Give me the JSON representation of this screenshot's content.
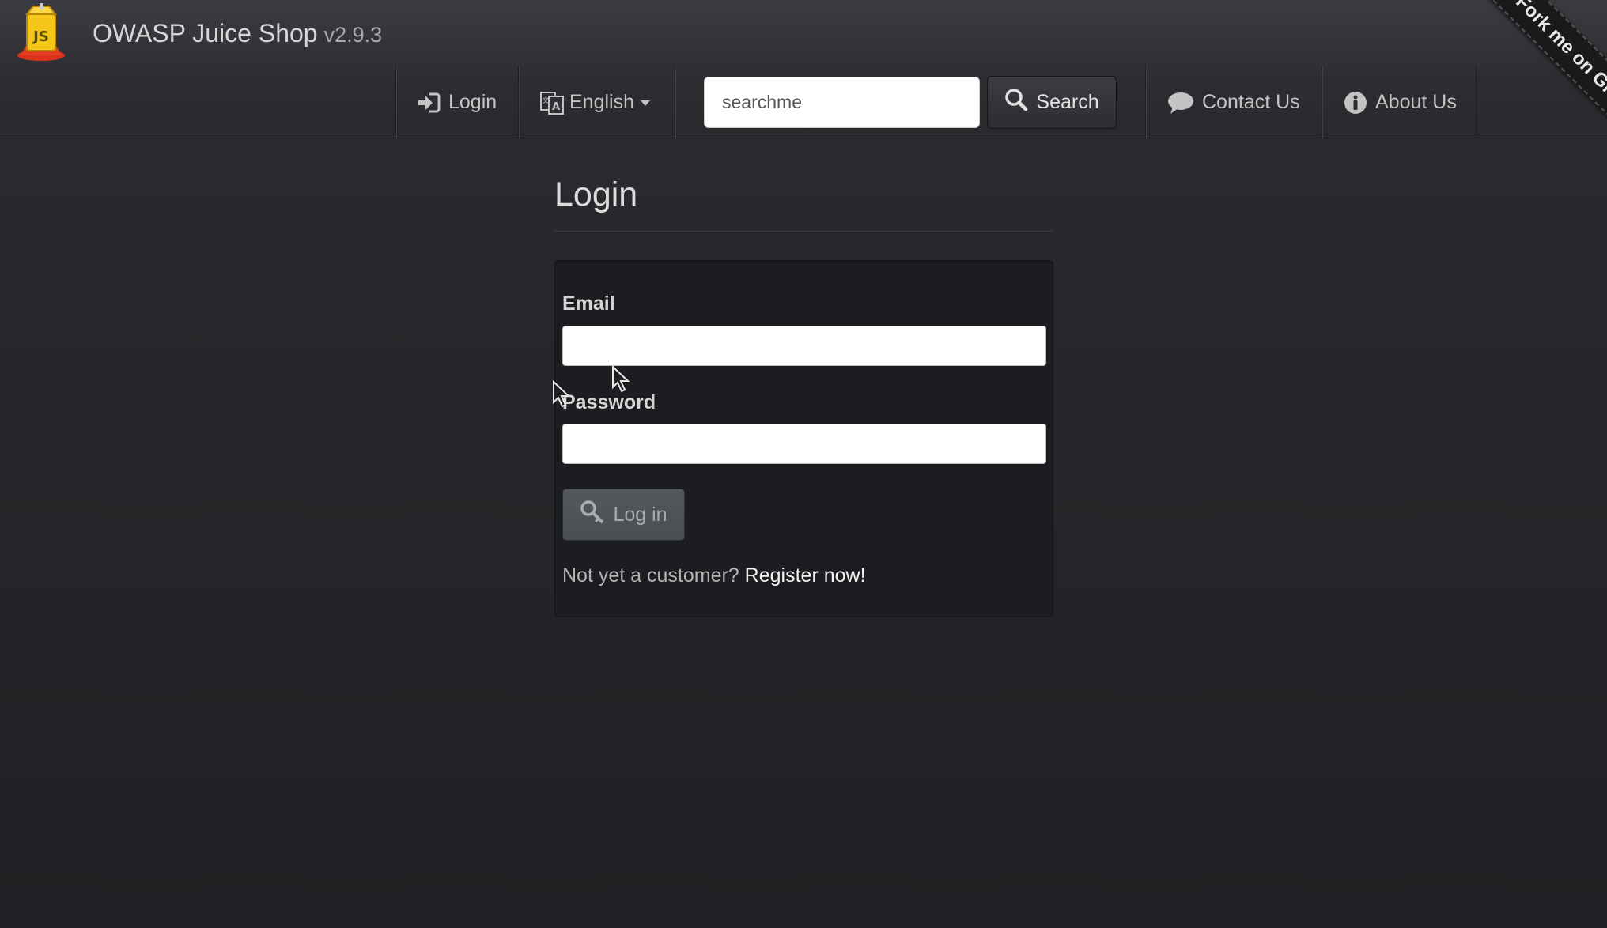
{
  "brand": {
    "name": "OWASP Juice Shop",
    "version": "v2.9.3",
    "logo_text": "JS"
  },
  "nav": {
    "login_label": "Login",
    "language_label": "English",
    "search_value": "searchme",
    "search_button_label": "Search",
    "contact_label": "Contact Us",
    "about_label": "About Us"
  },
  "ribbon": {
    "text": "Fork me on GitHub"
  },
  "login_form": {
    "title": "Login",
    "email_label": "Email",
    "email_value": "",
    "password_label": "Password",
    "password_value": "",
    "submit_label": "Log in",
    "register_prompt": "Not yet a customer?",
    "register_link": "Register now!"
  },
  "colors": {
    "background": "#222326",
    "navbar": "#2b2d31",
    "panel": "#1c1d20",
    "logo_yellow": "#f5c518",
    "logo_red": "#d9331a"
  },
  "icons": [
    "juice-shop-logo",
    "sign-in-icon",
    "language-icon",
    "caret-down-icon",
    "search-icon",
    "comment-icon",
    "info-icon",
    "key-icon",
    "mouse-cursor"
  ]
}
